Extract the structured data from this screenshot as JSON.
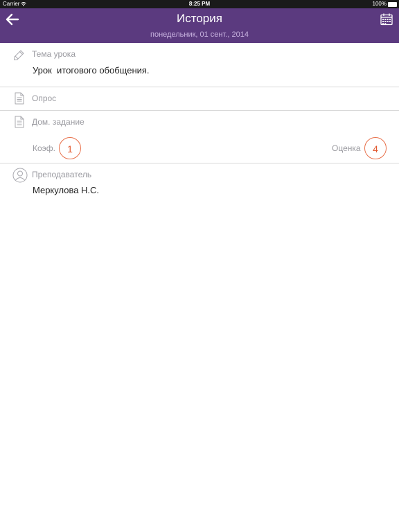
{
  "status_bar": {
    "carrier": "Carrier",
    "time": "8:25 PM",
    "battery": "100%"
  },
  "nav": {
    "title": "История",
    "subtitle": "понедельник, 01 сент., 2014"
  },
  "lesson_topic": {
    "label": "Тема урока",
    "value": "Урок  итогового обобщения."
  },
  "survey": {
    "label": "Опрос"
  },
  "homework": {
    "label": "Дом. задание",
    "coef_label": "Коэф.",
    "coef_value": "1",
    "grade_label": "Оценка",
    "grade_value": "4"
  },
  "teacher": {
    "label": "Преподаватель",
    "value": "Меркулова Н.С."
  },
  "colors": {
    "nav_background": "#5b3a7f",
    "accent": "#e2582e"
  }
}
